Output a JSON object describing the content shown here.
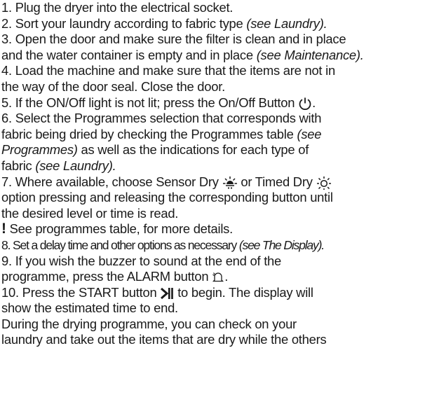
{
  "steps": {
    "s1": "1. Plug the dryer into the electrical socket.",
    "s2": "2. Sort your laundry according to fabric type ",
    "s2_ref": "(see Laundry).",
    "s3a": "3. Open the door and make sure the filter is clean and in place",
    "s3b": "and the water container is empty and in place ",
    "s3_ref": "(see Maintenance).",
    "s4a": "4. Load the machine and make sure that the items are not in",
    "s4b": "the way of the door seal. Close the door.",
    "s5": "5. If the ON/Off light is not lit; press the On/Off Button ",
    "s6a": "6. Select the Programmes selection that corresponds with",
    "s6b": "fabric being dried by checking the Programmes table ",
    "s6b_ref": "(see",
    "s6c_ref": "Programmes)",
    "s6c": " as well as the indications for each type of",
    "s6d": "fabric ",
    "s6d_ref": "(see Laundry).",
    "s7a_1": "7. Where available, choose Sensor Dry ",
    "s7a_2": " or Timed Dry ",
    "s7b": "option pressing and releasing the corresponding button until",
    "s7c": "the desired level or time is read.",
    "note_mark": "!",
    "note": " See programmes table, for more details.",
    "s8": "8. Set a delay time and other options as necessary ",
    "s8_ref": "(see The Display).",
    "s9a": "9. If you wish the buzzer to sound at the end of the",
    "s9b": "programme, press the ALARM button ",
    "s9b_end": ".",
    "s10a_1": "10. Press the START button ",
    "s10a_2": " to begin. The display will",
    "s10b": "show the estimated time to end.",
    "p1": "During the drying programme, you can check on your",
    "p2": "laundry and take out the items that are dry while the others"
  },
  "icons": [
    "power-icon",
    "sensor-dry-icon",
    "timed-dry-icon",
    "alarm-bell-icon",
    "start-pause-icon"
  ]
}
